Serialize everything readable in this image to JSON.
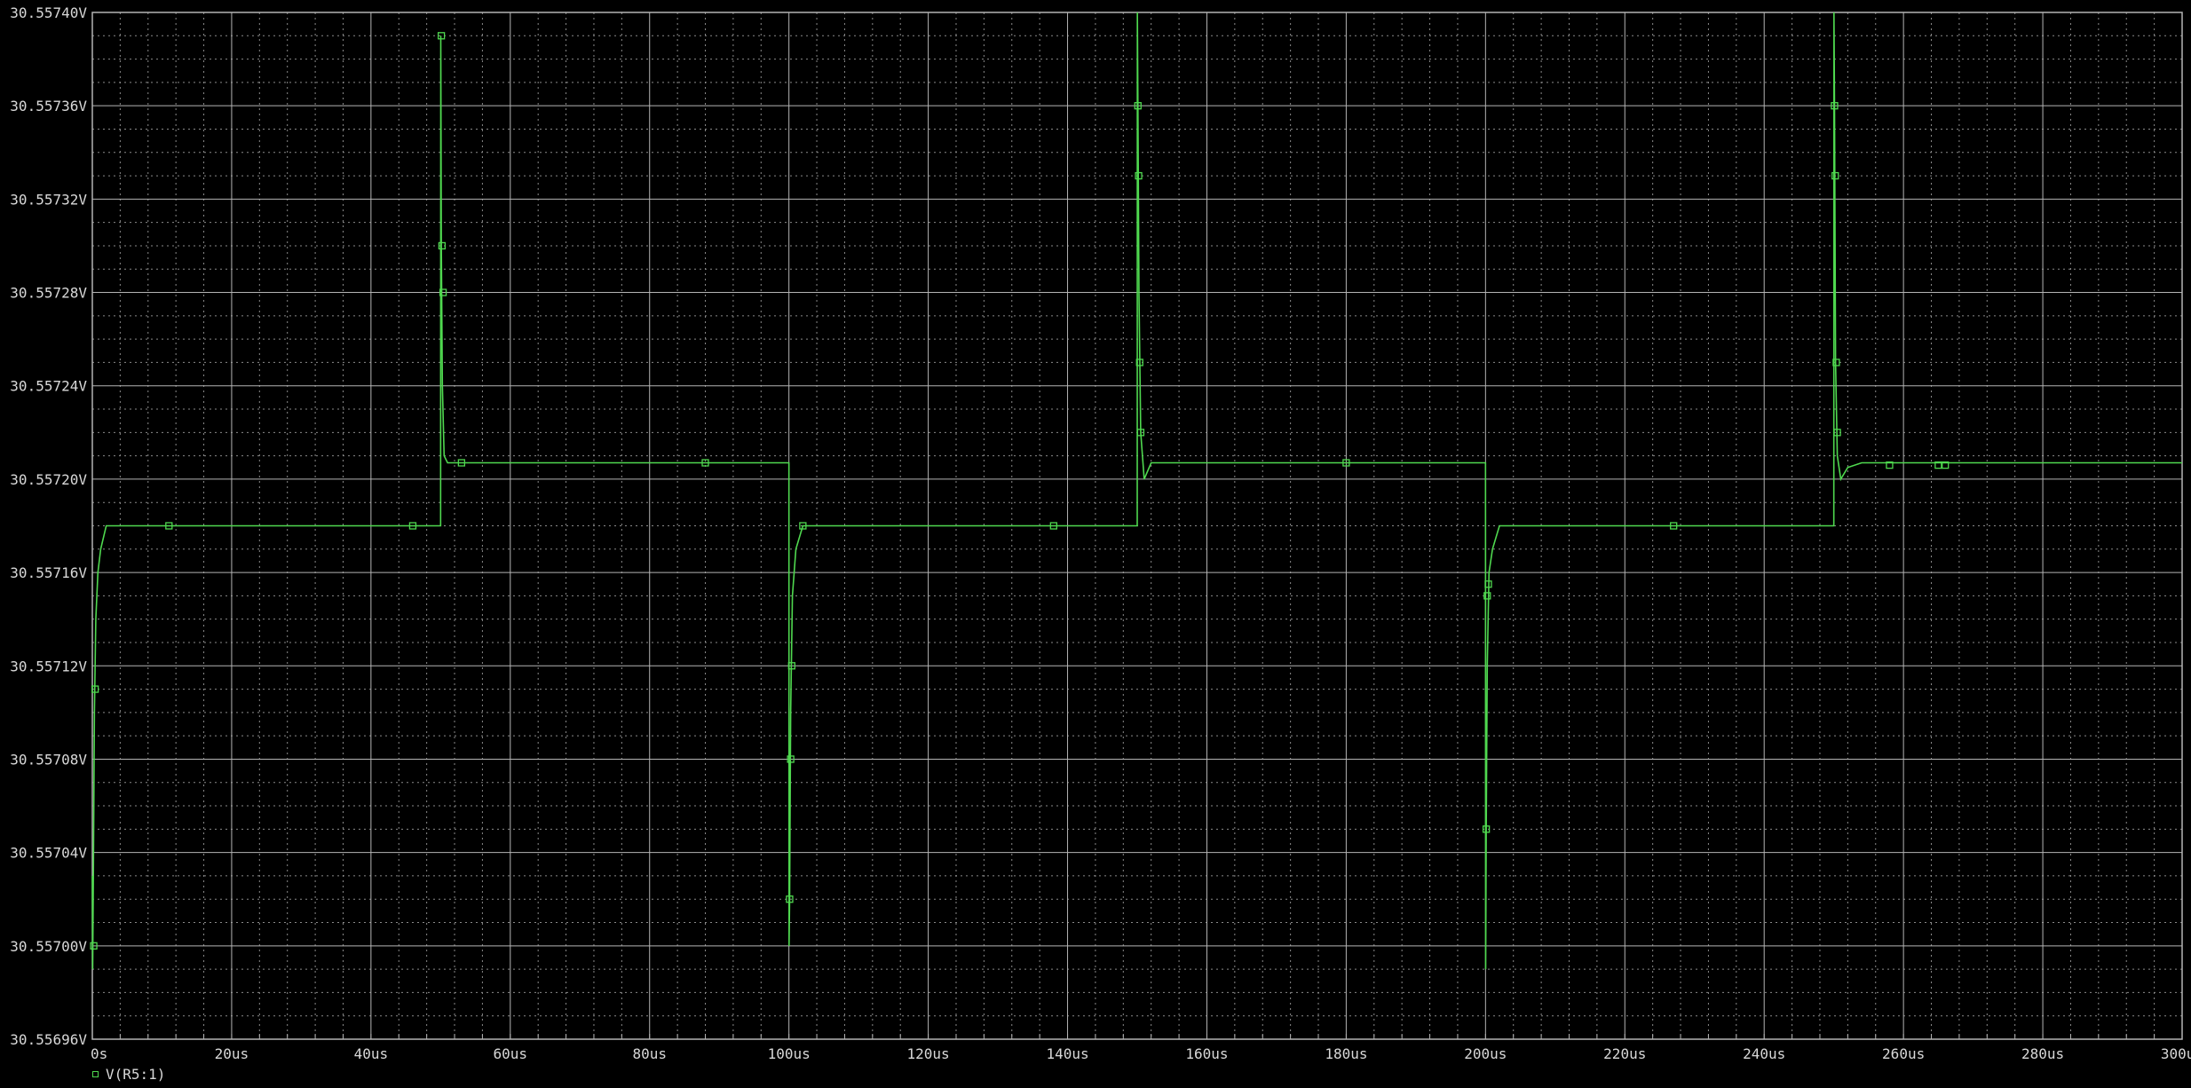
{
  "window": {
    "title": ""
  },
  "colors": {
    "background": "#000000",
    "grid_major": "#b4b4b4",
    "grid_minor": "#8a8a8a",
    "trace": "#4fd84f",
    "text": "#d8d8d8"
  },
  "legend": {
    "marker_icon": "square-marker-icon",
    "label": "V(R5:1)"
  },
  "chart_data": {
    "type": "line",
    "title": "",
    "xlabel": "",
    "ylabel": "",
    "x_unit": "us",
    "y_unit": "V",
    "xlim": [
      0,
      300
    ],
    "ylim": [
      30.55696,
      30.5574
    ],
    "grid": true,
    "legend_position": "bottom-left",
    "x_ticks": [
      0,
      20,
      40,
      60,
      80,
      100,
      120,
      140,
      160,
      180,
      200,
      220,
      240,
      260,
      280,
      300
    ],
    "x_tick_labels": [
      "0s",
      "20us",
      "40us",
      "60us",
      "80us",
      "100us",
      "120us",
      "140us",
      "160us",
      "180us",
      "200us",
      "220us",
      "240us",
      "260us",
      "280us",
      "300us"
    ],
    "y_ticks": [
      30.55696,
      30.557,
      30.55704,
      30.55708,
      30.55712,
      30.55716,
      30.5572,
      30.55724,
      30.55728,
      30.55732,
      30.55736,
      30.5574
    ],
    "y_tick_labels": [
      "30.55696V",
      "30.55700V",
      "30.55704V",
      "30.55708V",
      "30.55712V",
      "30.55716V",
      "30.55720V",
      "30.55724V",
      "30.55728V",
      "30.55732V",
      "30.55736V",
      "30.55740V"
    ],
    "series": [
      {
        "name": "V(R5:1)",
        "points": [
          [
            0,
            30.55703
          ],
          [
            0.05,
            30.55699
          ],
          [
            0.15,
            30.55703
          ],
          [
            0.3,
            30.5571
          ],
          [
            0.5,
            30.55714
          ],
          [
            0.8,
            30.55716
          ],
          [
            1.2,
            30.55717
          ],
          [
            2,
            30.55718
          ],
          [
            50,
            30.55718
          ],
          [
            50.02,
            30.55739
          ],
          [
            50.1,
            30.5573
          ],
          [
            50.25,
            30.55724
          ],
          [
            50.5,
            30.55721
          ],
          [
            51,
            30.557207
          ],
          [
            100,
            30.557207
          ],
          [
            100.02,
            30.557
          ],
          [
            100.1,
            30.55702
          ],
          [
            100.25,
            30.5571
          ],
          [
            100.5,
            30.55715
          ],
          [
            101,
            30.55717
          ],
          [
            102,
            30.55718
          ],
          [
            150,
            30.55718
          ],
          [
            150.02,
            30.5574
          ],
          [
            150.1,
            30.55736
          ],
          [
            150.25,
            30.55728
          ],
          [
            150.5,
            30.55722
          ],
          [
            151,
            30.5572
          ],
          [
            152,
            30.557207
          ],
          [
            200,
            30.557207
          ],
          [
            200.02,
            30.55699
          ],
          [
            200.1,
            30.55705
          ],
          [
            200.25,
            30.55712
          ],
          [
            200.5,
            30.55716
          ],
          [
            201,
            30.55717
          ],
          [
            202,
            30.55718
          ],
          [
            250,
            30.55718
          ],
          [
            250.02,
            30.5574
          ],
          [
            250.1,
            30.55736
          ],
          [
            250.25,
            30.55725
          ],
          [
            250.5,
            30.55721
          ],
          [
            251,
            30.5572
          ],
          [
            252,
            30.557205
          ],
          [
            254,
            30.557207
          ],
          [
            300,
            30.557207
          ]
        ],
        "markers": [
          [
            0.2,
            30.557
          ],
          [
            0.4,
            30.55711
          ],
          [
            11,
            30.55718
          ],
          [
            46,
            30.55718
          ],
          [
            50.1,
            30.55739
          ],
          [
            50.2,
            30.5573
          ],
          [
            50.35,
            30.55728
          ],
          [
            53,
            30.557207
          ],
          [
            88,
            30.557207
          ],
          [
            100.1,
            30.55702
          ],
          [
            100.25,
            30.55708
          ],
          [
            100.4,
            30.55712
          ],
          [
            102,
            30.55718
          ],
          [
            138,
            30.55718
          ],
          [
            150.1,
            30.55736
          ],
          [
            150.2,
            30.55733
          ],
          [
            150.35,
            30.55725
          ],
          [
            150.5,
            30.55722
          ],
          [
            180,
            30.557207
          ],
          [
            200.1,
            30.55705
          ],
          [
            200.25,
            30.55715
          ],
          [
            200.4,
            30.557155
          ],
          [
            227,
            30.55718
          ],
          [
            250.1,
            30.55736
          ],
          [
            250.2,
            30.55733
          ],
          [
            250.35,
            30.55725
          ],
          [
            250.5,
            30.55722
          ],
          [
            258,
            30.557206
          ],
          [
            265,
            30.557206
          ],
          [
            266,
            30.557206
          ]
        ]
      }
    ]
  }
}
